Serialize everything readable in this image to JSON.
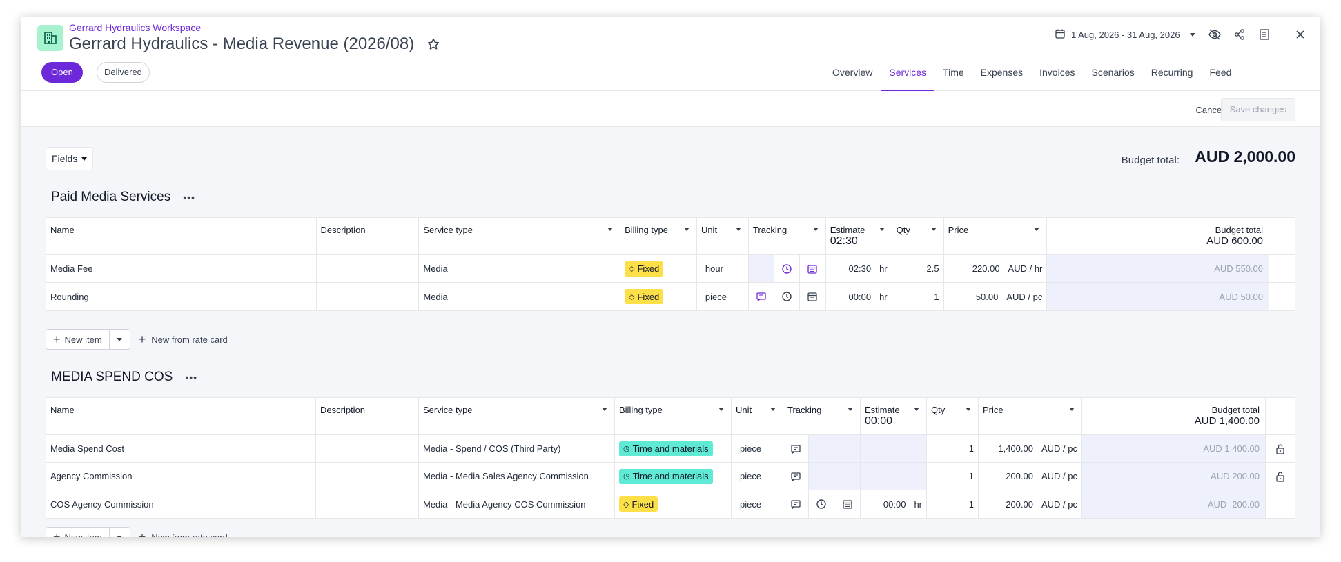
{
  "header": {
    "workspace": "Gerrard Hydraulics Workspace",
    "title": "Gerrard Hydraulics - Media Revenue (2026/08)",
    "status_open": "Open",
    "status_delivered": "Delivered",
    "date_range": "1 Aug, 2026 - 31 Aug, 2026",
    "brand_color": "#6d28d9"
  },
  "tabs": [
    "Overview",
    "Services",
    "Time",
    "Expenses",
    "Invoices",
    "Scenarios",
    "Recurring",
    "Feed"
  ],
  "active_tab": "Services",
  "actions": {
    "cancel": "Cancel",
    "save": "Save changes"
  },
  "toolbar": {
    "fields": "Fields"
  },
  "budget": {
    "label": "Budget total:",
    "value": "AUD 2,000.00"
  },
  "columns": {
    "name": "Name",
    "description": "Description",
    "service_type": "Service type",
    "billing_type": "Billing type",
    "unit": "Unit",
    "tracking": "Tracking",
    "estimate": "Estimate",
    "qty": "Qty",
    "price": "Price",
    "budget_total": "Budget total"
  },
  "sections": [
    {
      "title": "Paid Media Services",
      "estimate_total": "02:30",
      "budget_total": "AUD 600.00",
      "rows": [
        {
          "name": "Media Fee",
          "description": "",
          "service_type": "Media",
          "billing": "Fixed",
          "unit": "hour",
          "estimate": "02:30",
          "est_unit": "hr",
          "qty": "2.5",
          "price": "220.00",
          "price_unit": "AUD / hr",
          "total": "AUD 550.00"
        },
        {
          "name": "Rounding",
          "description": "",
          "service_type": "Media",
          "billing": "Fixed",
          "unit": "piece",
          "estimate": "00:00",
          "est_unit": "hr",
          "qty": "1",
          "price": "50.00",
          "price_unit": "AUD / pc",
          "total": "AUD 50.00"
        }
      ]
    },
    {
      "title": "MEDIA SPEND COS",
      "estimate_total": "00:00",
      "budget_total": "AUD 1,400.00",
      "rows": [
        {
          "name": "Media Spend Cost",
          "description": "",
          "service_type": "Media - Spend / COS (Third Party)",
          "billing": "Time and materials",
          "unit": "piece",
          "estimate": "",
          "est_unit": "",
          "qty": "1",
          "price": "1,400.00",
          "price_unit": "AUD / pc",
          "total": "AUD 1,400.00"
        },
        {
          "name": "Agency Commission",
          "description": "",
          "service_type": "Media - Media Sales Agency Commission",
          "billing": "Time and materials",
          "unit": "piece",
          "estimate": "",
          "est_unit": "",
          "qty": "1",
          "price": "200.00",
          "price_unit": "AUD / pc",
          "total": "AUD 200.00"
        },
        {
          "name": "COS Agency Commission",
          "description": "",
          "service_type": "Media - Media Agency COS Commission",
          "billing": "Fixed",
          "unit": "piece",
          "estimate": "00:00",
          "est_unit": "hr",
          "qty": "1",
          "price": "-200.00",
          "price_unit": "AUD / pc",
          "total": "AUD -200.00"
        }
      ]
    }
  ],
  "new_item": "New item",
  "new_from_rate_card": "New from rate card"
}
